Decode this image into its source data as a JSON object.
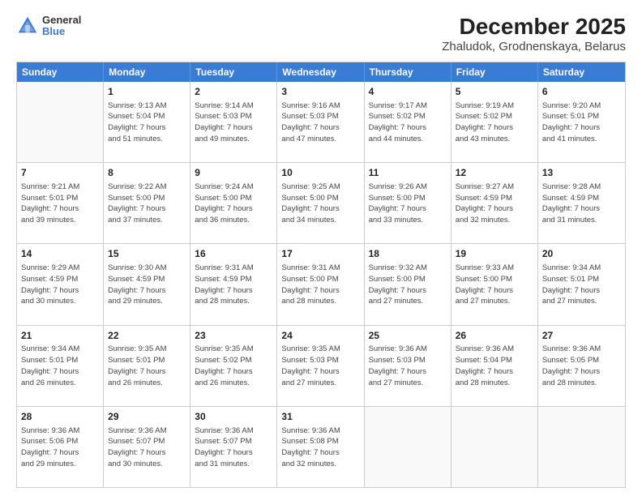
{
  "header": {
    "logo": {
      "line1": "General",
      "line2": "Blue"
    },
    "title": "December 2025",
    "subtitle": "Zhaludok, Grodnenskaya, Belarus"
  },
  "weekdays": [
    "Sunday",
    "Monday",
    "Tuesday",
    "Wednesday",
    "Thursday",
    "Friday",
    "Saturday"
  ],
  "weeks": [
    [
      {
        "day": "",
        "info": ""
      },
      {
        "day": "1",
        "info": "Sunrise: 9:13 AM\nSunset: 5:04 PM\nDaylight: 7 hours\nand 51 minutes."
      },
      {
        "day": "2",
        "info": "Sunrise: 9:14 AM\nSunset: 5:03 PM\nDaylight: 7 hours\nand 49 minutes."
      },
      {
        "day": "3",
        "info": "Sunrise: 9:16 AM\nSunset: 5:03 PM\nDaylight: 7 hours\nand 47 minutes."
      },
      {
        "day": "4",
        "info": "Sunrise: 9:17 AM\nSunset: 5:02 PM\nDaylight: 7 hours\nand 44 minutes."
      },
      {
        "day": "5",
        "info": "Sunrise: 9:19 AM\nSunset: 5:02 PM\nDaylight: 7 hours\nand 43 minutes."
      },
      {
        "day": "6",
        "info": "Sunrise: 9:20 AM\nSunset: 5:01 PM\nDaylight: 7 hours\nand 41 minutes."
      }
    ],
    [
      {
        "day": "7",
        "info": "Sunrise: 9:21 AM\nSunset: 5:01 PM\nDaylight: 7 hours\nand 39 minutes."
      },
      {
        "day": "8",
        "info": "Sunrise: 9:22 AM\nSunset: 5:00 PM\nDaylight: 7 hours\nand 37 minutes."
      },
      {
        "day": "9",
        "info": "Sunrise: 9:24 AM\nSunset: 5:00 PM\nDaylight: 7 hours\nand 36 minutes."
      },
      {
        "day": "10",
        "info": "Sunrise: 9:25 AM\nSunset: 5:00 PM\nDaylight: 7 hours\nand 34 minutes."
      },
      {
        "day": "11",
        "info": "Sunrise: 9:26 AM\nSunset: 5:00 PM\nDaylight: 7 hours\nand 33 minutes."
      },
      {
        "day": "12",
        "info": "Sunrise: 9:27 AM\nSunset: 4:59 PM\nDaylight: 7 hours\nand 32 minutes."
      },
      {
        "day": "13",
        "info": "Sunrise: 9:28 AM\nSunset: 4:59 PM\nDaylight: 7 hours\nand 31 minutes."
      }
    ],
    [
      {
        "day": "14",
        "info": "Sunrise: 9:29 AM\nSunset: 4:59 PM\nDaylight: 7 hours\nand 30 minutes."
      },
      {
        "day": "15",
        "info": "Sunrise: 9:30 AM\nSunset: 4:59 PM\nDaylight: 7 hours\nand 29 minutes."
      },
      {
        "day": "16",
        "info": "Sunrise: 9:31 AM\nSunset: 4:59 PM\nDaylight: 7 hours\nand 28 minutes."
      },
      {
        "day": "17",
        "info": "Sunrise: 9:31 AM\nSunset: 5:00 PM\nDaylight: 7 hours\nand 28 minutes."
      },
      {
        "day": "18",
        "info": "Sunrise: 9:32 AM\nSunset: 5:00 PM\nDaylight: 7 hours\nand 27 minutes."
      },
      {
        "day": "19",
        "info": "Sunrise: 9:33 AM\nSunset: 5:00 PM\nDaylight: 7 hours\nand 27 minutes."
      },
      {
        "day": "20",
        "info": "Sunrise: 9:34 AM\nSunset: 5:01 PM\nDaylight: 7 hours\nand 27 minutes."
      }
    ],
    [
      {
        "day": "21",
        "info": "Sunrise: 9:34 AM\nSunset: 5:01 PM\nDaylight: 7 hours\nand 26 minutes."
      },
      {
        "day": "22",
        "info": "Sunrise: 9:35 AM\nSunset: 5:01 PM\nDaylight: 7 hours\nand 26 minutes."
      },
      {
        "day": "23",
        "info": "Sunrise: 9:35 AM\nSunset: 5:02 PM\nDaylight: 7 hours\nand 26 minutes."
      },
      {
        "day": "24",
        "info": "Sunrise: 9:35 AM\nSunset: 5:03 PM\nDaylight: 7 hours\nand 27 minutes."
      },
      {
        "day": "25",
        "info": "Sunrise: 9:36 AM\nSunset: 5:03 PM\nDaylight: 7 hours\nand 27 minutes."
      },
      {
        "day": "26",
        "info": "Sunrise: 9:36 AM\nSunset: 5:04 PM\nDaylight: 7 hours\nand 28 minutes."
      },
      {
        "day": "27",
        "info": "Sunrise: 9:36 AM\nSunset: 5:05 PM\nDaylight: 7 hours\nand 28 minutes."
      }
    ],
    [
      {
        "day": "28",
        "info": "Sunrise: 9:36 AM\nSunset: 5:06 PM\nDaylight: 7 hours\nand 29 minutes."
      },
      {
        "day": "29",
        "info": "Sunrise: 9:36 AM\nSunset: 5:07 PM\nDaylight: 7 hours\nand 30 minutes."
      },
      {
        "day": "30",
        "info": "Sunrise: 9:36 AM\nSunset: 5:07 PM\nDaylight: 7 hours\nand 31 minutes."
      },
      {
        "day": "31",
        "info": "Sunrise: 9:36 AM\nSunset: 5:08 PM\nDaylight: 7 hours\nand 32 minutes."
      },
      {
        "day": "",
        "info": ""
      },
      {
        "day": "",
        "info": ""
      },
      {
        "day": "",
        "info": ""
      }
    ]
  ]
}
